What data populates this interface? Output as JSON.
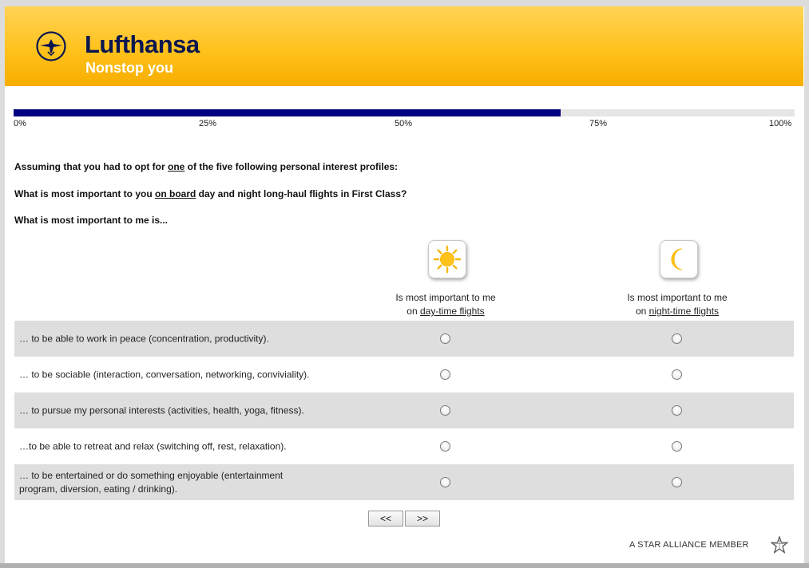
{
  "header": {
    "brand_name": "Lufthansa",
    "slogan": "Nonstop you",
    "icon": "crane-logo-icon",
    "colors": {
      "background": "#ffc21c",
      "brand": "#0a1650",
      "slogan": "#ffffff"
    }
  },
  "progress": {
    "value_percent": 70,
    "fill_color": "#000080",
    "labels": [
      "0%",
      "25%",
      "50%",
      "75%",
      "100%"
    ]
  },
  "survey": {
    "intro": {
      "before": "Assuming that you had to opt for ",
      "underlined": "one",
      "after": " of the five following personal interest profiles:"
    },
    "question": {
      "before": "What is most important to you ",
      "underlined": "on board",
      "after": " day and night long-haul flights in First Class?"
    },
    "lead_in": "What is most important to me is...",
    "columns": [
      {
        "icon": "sun-icon",
        "line1": "Is most important to me",
        "line2_prefix": "on ",
        "line2_underlined": "day-time flights"
      },
      {
        "icon": "moon-icon",
        "line1": "Is most important to me",
        "line2_prefix": "on ",
        "line2_underlined": "night-time flights"
      }
    ],
    "rows": [
      {
        "label": "… to be able to work in peace (concentration, productivity)."
      },
      {
        "label": "… to be sociable (interaction, conversation, networking, conviviality)."
      },
      {
        "label": "… to pursue my personal interests (activities, health, yoga, fitness)."
      },
      {
        "label": "…to be able to retreat and relax (switching off, rest, relaxation)."
      },
      {
        "label": "… to be entertained or do something enjoyable (entertainment program, diversion, eating / drinking)."
      }
    ]
  },
  "navigation": {
    "back_label": "<<",
    "next_label": ">>"
  },
  "footer": {
    "alliance_text": "A STAR ALLIANCE MEMBER",
    "icon": "star-alliance-icon"
  }
}
